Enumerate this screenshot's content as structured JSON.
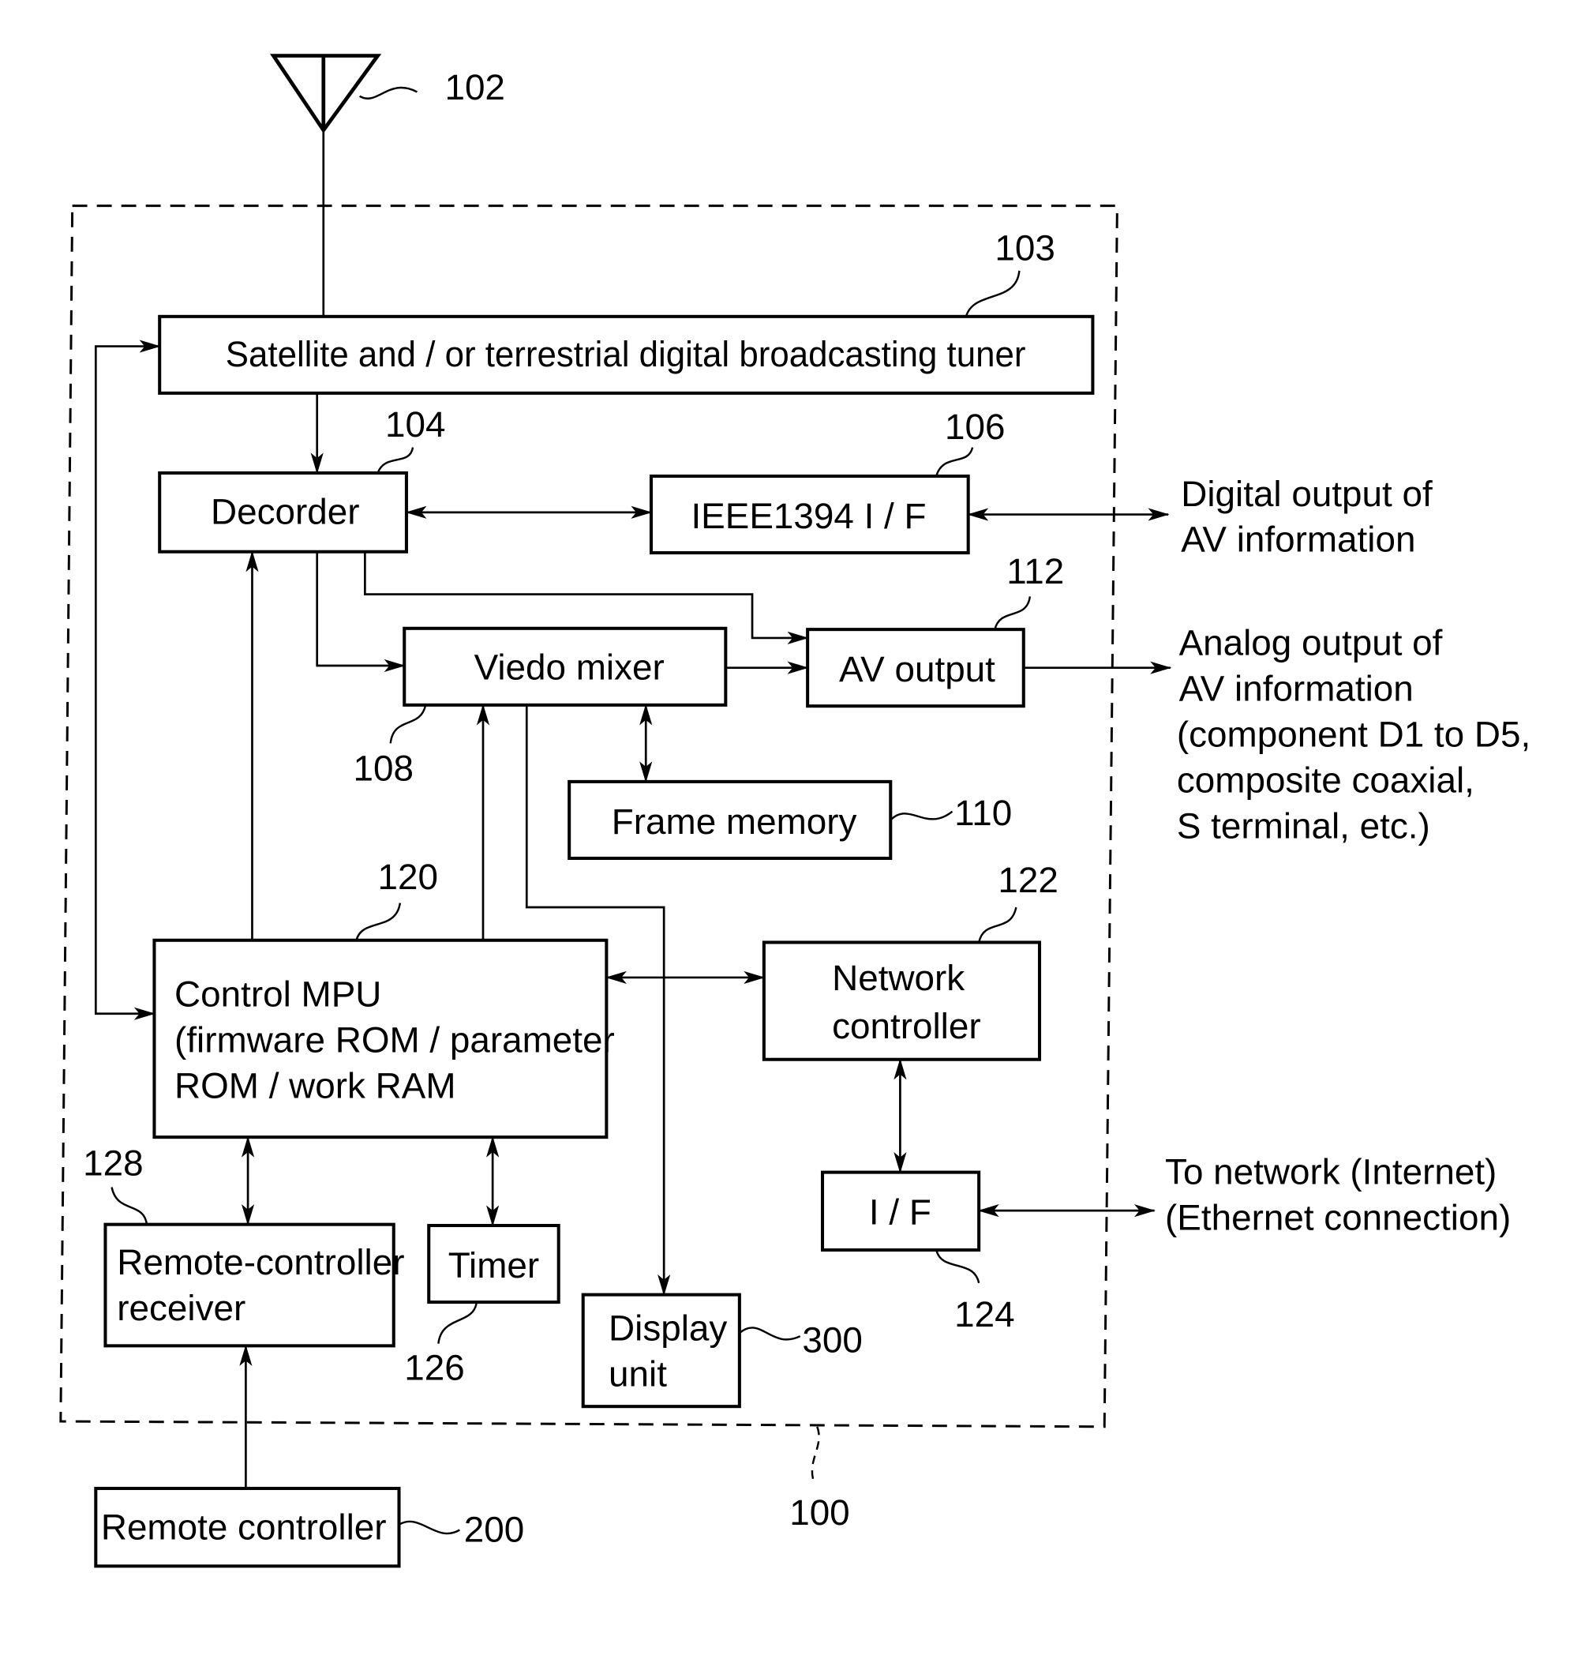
{
  "figure": {
    "antenna": {
      "ref": "102"
    },
    "system": {
      "ref": "100"
    },
    "blocks": {
      "tuner": {
        "label": "Satellite  and / or  terrestrial  digital  broadcasting  tuner",
        "ref": "103"
      },
      "decoder": {
        "label": "Decorder",
        "ref": "104"
      },
      "ieee1394": {
        "label": "IEEE1394  I / F",
        "ref": "106"
      },
      "video_mixer": {
        "label": "Viedo  mixer",
        "ref": "108"
      },
      "av_output": {
        "label": "AV  output",
        "ref": "112"
      },
      "frame_memory": {
        "label": "Frame  memory",
        "ref": "110"
      },
      "control_mpu": {
        "lines": [
          "Control  MPU",
          "(firmware  ROM / parameter",
          "ROM / work  RAM"
        ],
        "ref": "120"
      },
      "network_controller": {
        "lines": [
          "Network",
          "controller"
        ],
        "ref": "122"
      },
      "network_if": {
        "label": "I / F",
        "ref": "124"
      },
      "remote_receiver": {
        "lines": [
          "Remote-controller",
          "receiver"
        ],
        "ref": "128"
      },
      "timer": {
        "label": "Timer",
        "ref": "126"
      },
      "display_unit": {
        "lines": [
          "Display",
          "unit"
        ],
        "ref": "300"
      },
      "remote_controller": {
        "label": "Remote  controller",
        "ref": "200"
      }
    },
    "external_labels": {
      "digital_output": [
        "Digital  output  of",
        "AV  information"
      ],
      "analog_output": [
        "Analog  output  of",
        "AV  information",
        "(component  D1  to  D5,",
        "composite  coaxial,",
        "S  terminal, etc.)"
      ],
      "network": [
        "To  network (Internet)",
        "(Ethernet  connection)"
      ]
    }
  }
}
